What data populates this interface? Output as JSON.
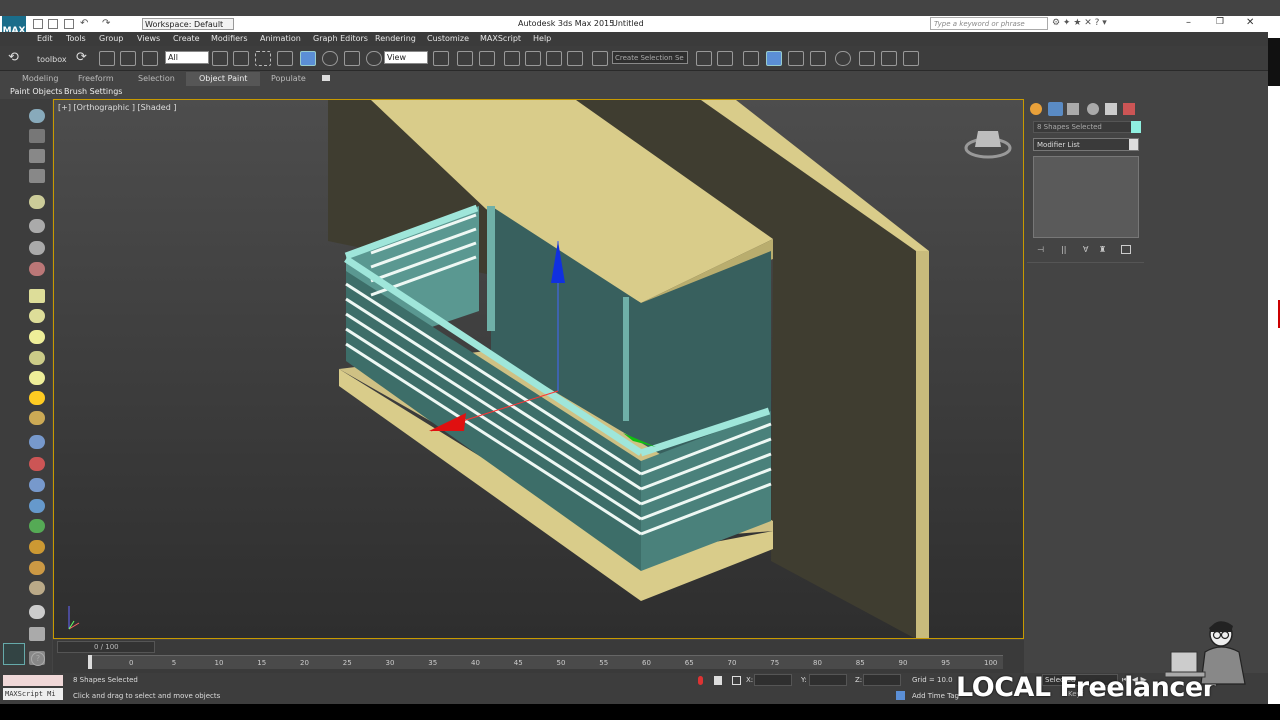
{
  "window": {
    "title_app": "Autodesk 3ds Max  2015",
    "title_doc": "Untitled",
    "workspace": "Workspace: Default",
    "search_placeholder": "Type a keyword or phrase"
  },
  "menu": [
    "Edit",
    "Tools",
    "Group",
    "Views",
    "Create",
    "Modifiers",
    "Animation",
    "Graph Editors",
    "Rendering",
    "Customize",
    "MAXScript",
    "Help"
  ],
  "toolbar": {
    "toolbox_label": "toolbox",
    "filter_value": "All",
    "refcoord_value": "View",
    "selection_set_value": "Create Selection Se"
  },
  "ribbon": {
    "tabs": [
      "Modeling",
      "Freeform",
      "Selection",
      "Object Paint",
      "Populate"
    ],
    "active_tab": "Object Paint",
    "subtabs": [
      "Paint Objects",
      "Brush Settings"
    ]
  },
  "viewport": {
    "label": "[+] [Orthographic ] [Shaded ]"
  },
  "command_panel": {
    "selection_name": "8 Shapes Selected",
    "modifier_list": "Modifier List",
    "swatch_color": "#8ff0e0"
  },
  "timeline": {
    "frame_display": "0 / 100",
    "ticks": [
      "0",
      "5",
      "10",
      "15",
      "20",
      "25",
      "30",
      "35",
      "40",
      "45",
      "50",
      "55",
      "60",
      "65",
      "70",
      "75",
      "80",
      "85",
      "90",
      "95",
      "100"
    ]
  },
  "status": {
    "selection_count": "8 Shapes Selected",
    "prompt": "Click and drag to select and move objects",
    "maxscript": "MAXScript Mi",
    "x_label": "X:",
    "y_label": "Y:",
    "z_label": "Z:",
    "grid": "Grid = 10.0",
    "add_time_tag": "Add Time Tag",
    "selected_dropdown": "Selected",
    "key_filter": "Keyf"
  },
  "watermark": {
    "text": "LOCAL Freelancer"
  }
}
